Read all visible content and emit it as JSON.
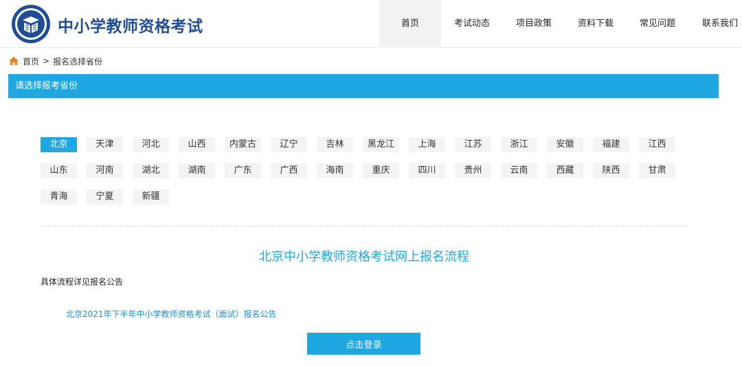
{
  "header": {
    "site_title": "中小学教师资格考试",
    "nav": [
      {
        "label": "首页",
        "active": true
      },
      {
        "label": "考试动态",
        "active": false
      },
      {
        "label": "项目政策",
        "active": false
      },
      {
        "label": "资料下载",
        "active": false
      },
      {
        "label": "常见问题",
        "active": false
      },
      {
        "label": "联系我们",
        "active": false
      }
    ]
  },
  "breadcrumb": {
    "home": "首页",
    "separator": ">",
    "current": "报名选择省份"
  },
  "section": {
    "title": "请选择报考省份"
  },
  "provinces": {
    "selected": "北京",
    "items": [
      "北京",
      "天津",
      "河北",
      "山西",
      "内蒙古",
      "辽宁",
      "吉林",
      "黑龙江",
      "上海",
      "江苏",
      "浙江",
      "安徽",
      "福建",
      "江西",
      "山东",
      "河南",
      "湖北",
      "湖南",
      "广东",
      "广西",
      "海南",
      "重庆",
      "四川",
      "贵州",
      "云南",
      "西藏",
      "陕西",
      "甘肃",
      "青海",
      "宁夏",
      "新疆"
    ]
  },
  "flow": {
    "title": "北京中小学教师资格考试网上报名流程",
    "description": "具体流程详见报名公告",
    "notice_link": "北京2021年下半年中小学教师资格考试（面试）报名公告",
    "login_button": "点击登录"
  },
  "colors": {
    "accent": "#1fa7e1",
    "brand": "#1f4e96",
    "home_icon": "#f08519"
  }
}
